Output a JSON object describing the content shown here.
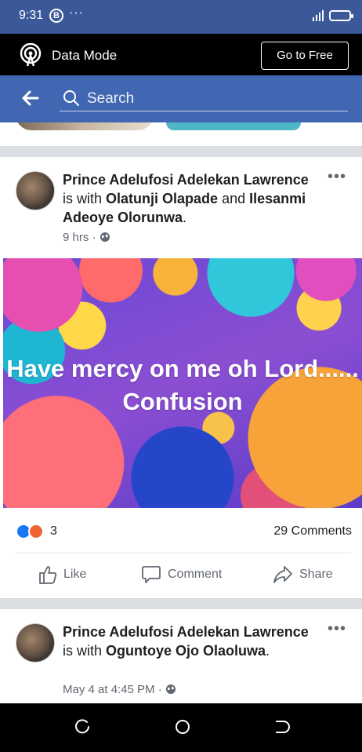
{
  "status_bar": {
    "time": "9:31",
    "b_badge": "B",
    "dots": "···"
  },
  "data_bar": {
    "label": "Data Mode",
    "cta": "Go to Free"
  },
  "search": {
    "placeholder": "Search"
  },
  "posts": [
    {
      "author": "Prince Adelufosi Adelekan Lawrence",
      "with_text": "is with",
      "tagged_1": "Olatunji Olapade",
      "and_text": "and",
      "tagged_2": "Ilesanmi Adeoye Olorunwa",
      "end": ".",
      "time": "9 hrs",
      "dot": "·",
      "more": "•••",
      "caption": "Have mercy on me oh Lord...... Confusion",
      "reaction_count": "3",
      "comments": "29 Comments"
    },
    {
      "author": "Prince Adelufosi Adelekan Lawrence",
      "with_text": "is with",
      "tagged_1": "Oguntoye Ojo Olaoluwa",
      "end": ".",
      "time": "May 4 at 4:45 PM",
      "dot": "·",
      "more": "•••"
    }
  ],
  "actions": {
    "like": "Like",
    "comment": "Comment",
    "share": "Share"
  },
  "icons": {
    "data_mode": "broadcast-icon",
    "back": "arrow-left-icon",
    "search": "search-icon",
    "privacy": "globe-icon",
    "like": "thumbs-up-icon",
    "comment": "speech-bubble-icon",
    "share": "share-arrow-icon",
    "nav_recent": "recent-apps-icon",
    "nav_home": "home-circle-icon",
    "nav_back": "nav-back-icon"
  },
  "colors": {
    "brand": "#3b5998",
    "search_bar": "#4267b2",
    "like": "#1877f2",
    "angry": "#f0652f"
  }
}
